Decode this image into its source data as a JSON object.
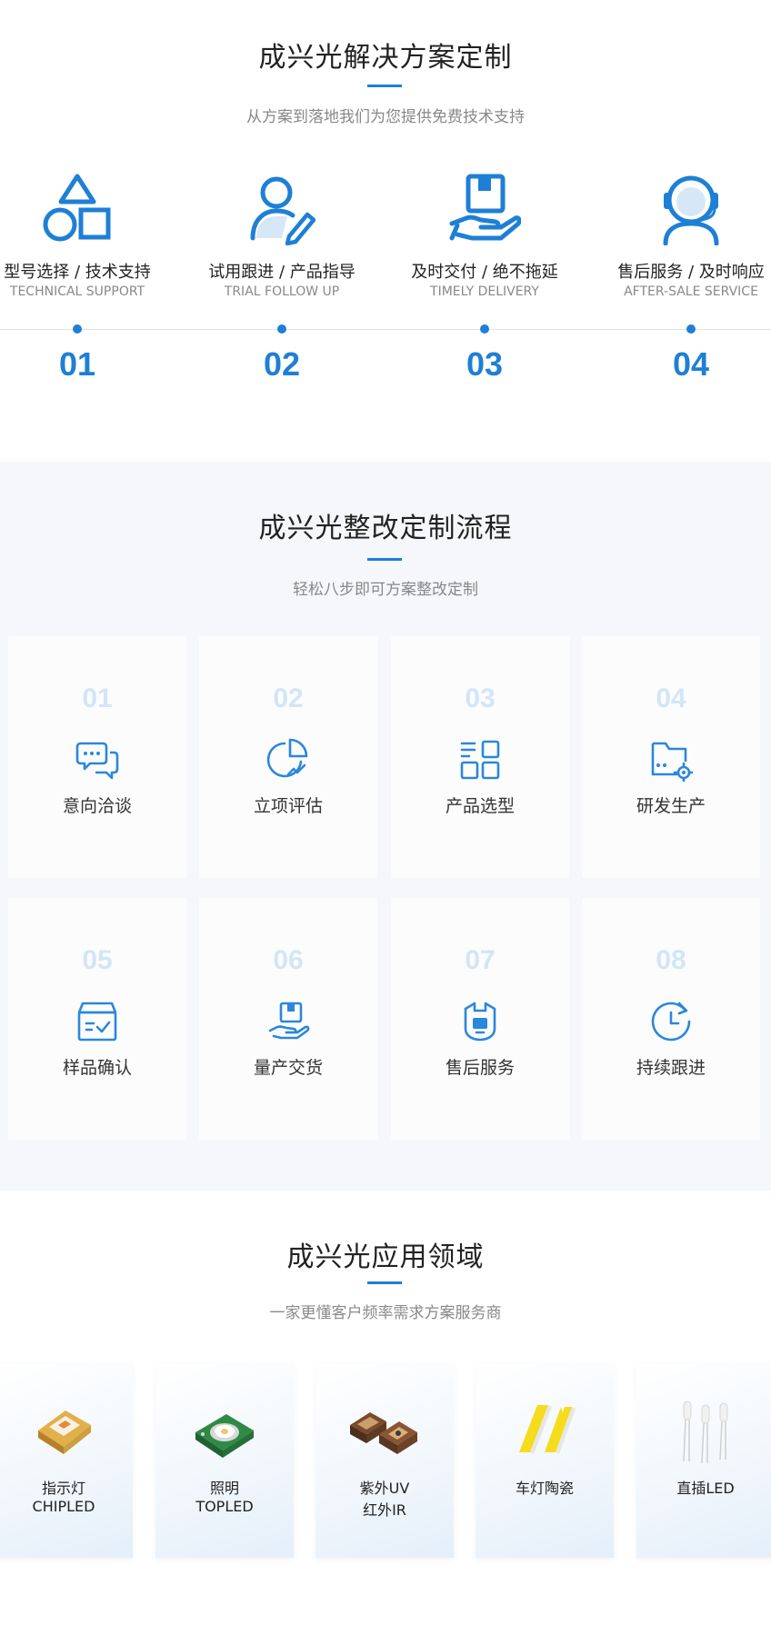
{
  "solutions": {
    "title": "成兴光解决方案定制",
    "subtitle": "从方案到落地我们为您提供免费技术支持",
    "items": [
      {
        "icon": "shapes-icon",
        "cn": "型号选择 / 技术支持",
        "en": "TECHNICAL SUPPORT",
        "num": "01"
      },
      {
        "icon": "user-edit-icon",
        "cn": "试用跟进 / 产品指导",
        "en": "TRIAL FOLLOW UP",
        "num": "02"
      },
      {
        "icon": "box-in-hand-icon",
        "cn": "及时交付 / 绝不拖延",
        "en": "TIMELY DELIVERY",
        "num": "03"
      },
      {
        "icon": "headset-icon",
        "cn": "售后服务 / 及时响应",
        "en": "AFTER-SALE SERVICE",
        "num": "04"
      }
    ]
  },
  "process": {
    "title": "成兴光整改定制流程",
    "subtitle": "轻松八步即可方案整改定制",
    "steps": [
      {
        "num": "01",
        "label": "意向洽谈",
        "icon": "chat-bubbles-icon"
      },
      {
        "num": "02",
        "label": "立项评估",
        "icon": "pie-chart-icon"
      },
      {
        "num": "03",
        "label": "产品选型",
        "icon": "grid-select-icon"
      },
      {
        "num": "04",
        "label": "研发生产",
        "icon": "folder-gear-icon"
      },
      {
        "num": "05",
        "label": "样品确认",
        "icon": "box-check-icon"
      },
      {
        "num": "06",
        "label": "量产交货",
        "icon": "package-hand-icon"
      },
      {
        "num": "07",
        "label": "售后服务",
        "icon": "service-icon"
      },
      {
        "num": "08",
        "label": "持续跟进",
        "icon": "clock-refresh-icon"
      }
    ]
  },
  "applications": {
    "title": "成兴光应用领域",
    "subtitle": "一家更懂客户频率需求方案服务商",
    "cards": [
      {
        "line1": "指示灯",
        "line2": "CHIPLED",
        "image": "chip-led-image"
      },
      {
        "line1": "照明",
        "line2": "TOPLED",
        "image": "top-led-image"
      },
      {
        "line1": "紫外UV",
        "line2": "红外IR",
        "image": "uv-ir-led-image"
      },
      {
        "line1": "车灯陶瓷",
        "line2": "",
        "image": "ceramic-led-image"
      },
      {
        "line1": "直插LED",
        "line2": "",
        "image": "through-hole-led-image"
      }
    ]
  },
  "colors": {
    "accent": "#1e7fd6",
    "step_number": "#d3e5f6",
    "section_bg": "#f5f7fa"
  }
}
